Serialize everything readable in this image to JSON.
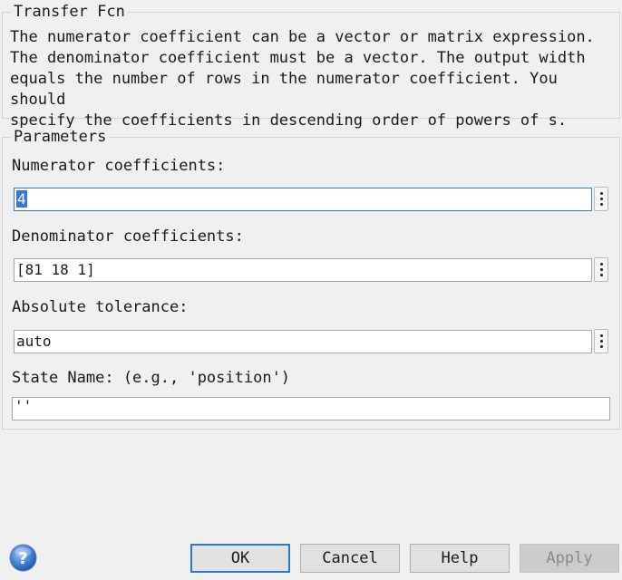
{
  "block": {
    "title": "Transfer Fcn",
    "description": "The numerator coefficient can be a vector or matrix expression.\nThe denominator coefficient must be a vector. The output width\nequals the number of rows in the numerator coefficient. You should\nspecify the coefficients in descending order of powers of s."
  },
  "parameters": {
    "title": "Parameters",
    "numerator": {
      "label": "Numerator coefficients:",
      "value": "4"
    },
    "denominator": {
      "label": "Denominator coefficients:",
      "value": "[81 18 1]"
    },
    "tolerance": {
      "label": "Absolute tolerance:",
      "value": "auto"
    },
    "state_name": {
      "label": "State Name: (e.g., 'position')",
      "value": "''"
    }
  },
  "buttons": {
    "ok": "OK",
    "cancel": "Cancel",
    "help": "Help",
    "apply": "Apply"
  },
  "icons": {
    "help": "help-question-icon",
    "more": "vertical-ellipsis-icon"
  },
  "colors": {
    "focus_border": "#3c7fb1",
    "selection": "#3875d7",
    "default_button_border": "#2b78c9"
  }
}
